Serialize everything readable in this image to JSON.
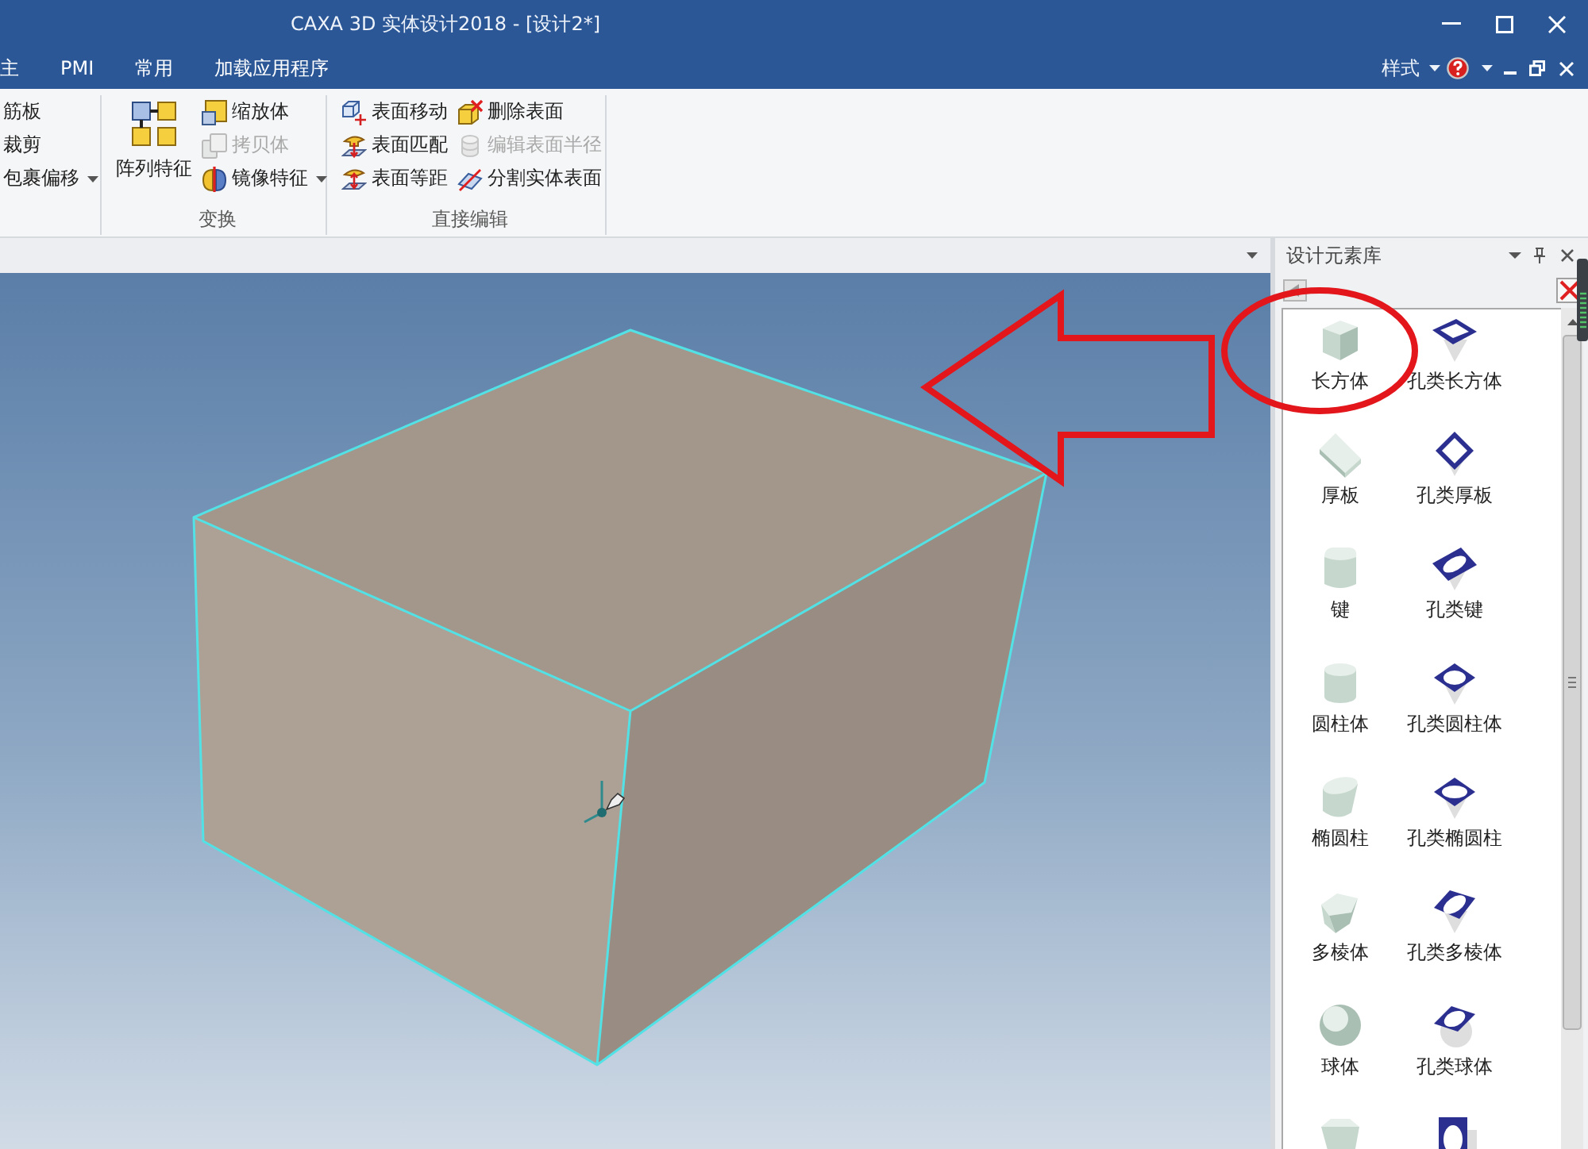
{
  "window": {
    "title": "CAXA 3D 实体设计2018 - [设计2*]"
  },
  "menu_bar": {
    "tabs": [
      {
        "label": "主",
        "selected": false
      },
      {
        "label": "PMI",
        "selected": false
      },
      {
        "label": "常用",
        "selected": false
      },
      {
        "label": "加载应用程序",
        "selected": false
      }
    ],
    "style_menu": "样式"
  },
  "ribbon": {
    "groups": [
      {
        "items": [
          {
            "label": "筋板",
            "kind": "small",
            "disabled": false,
            "dropdown": false
          },
          {
            "label": "裁剪",
            "kind": "small",
            "disabled": false,
            "dropdown": false
          },
          {
            "label": "包裹偏移",
            "kind": "small",
            "disabled": false,
            "dropdown": true
          }
        ]
      },
      {
        "label": "变换",
        "items": [
          {
            "label": "阵列特征",
            "kind": "large",
            "disabled": false,
            "dropdown": false
          },
          {
            "label": "缩放体",
            "kind": "small",
            "disabled": false,
            "dropdown": false
          },
          {
            "label": "拷贝体",
            "kind": "small",
            "disabled": true,
            "dropdown": false
          },
          {
            "label": "镜像特征",
            "kind": "small",
            "disabled": false,
            "dropdown": true
          }
        ]
      },
      {
        "label": "直接编辑",
        "items": [
          {
            "label": "表面移动",
            "kind": "small",
            "disabled": false,
            "dropdown": false
          },
          {
            "label": "表面匹配",
            "kind": "small",
            "disabled": false,
            "dropdown": false
          },
          {
            "label": "表面等距",
            "kind": "small",
            "disabled": false,
            "dropdown": false
          },
          {
            "label": "删除表面",
            "kind": "small",
            "disabled": false,
            "dropdown": false
          },
          {
            "label": "编辑表面半径",
            "kind": "small",
            "disabled": true,
            "dropdown": false
          },
          {
            "label": "分割实体表面",
            "kind": "small",
            "disabled": false,
            "dropdown": false
          }
        ]
      }
    ]
  },
  "design_library": {
    "title": "设计元素库",
    "items": [
      {
        "kind": "solid",
        "label": "长方体"
      },
      {
        "kind": "hole",
        "label": "孔类长方体"
      },
      {
        "kind": "solid",
        "label": "厚板"
      },
      {
        "kind": "hole",
        "label": "孔类厚板"
      },
      {
        "kind": "solid",
        "label": "键"
      },
      {
        "kind": "hole",
        "label": "孔类键"
      },
      {
        "kind": "solid",
        "label": "圆柱体"
      },
      {
        "kind": "hole",
        "label": "孔类圆柱体"
      },
      {
        "kind": "solid",
        "label": "椭圆柱"
      },
      {
        "kind": "hole",
        "label": "孔类椭圆柱"
      },
      {
        "kind": "solid",
        "label": "多棱体"
      },
      {
        "kind": "hole",
        "label": "孔类多棱体"
      },
      {
        "kind": "solid",
        "label": "球体"
      },
      {
        "kind": "hole",
        "label": "孔类球体"
      },
      {
        "kind": "solid"
      },
      {
        "kind": "hole"
      }
    ]
  }
}
